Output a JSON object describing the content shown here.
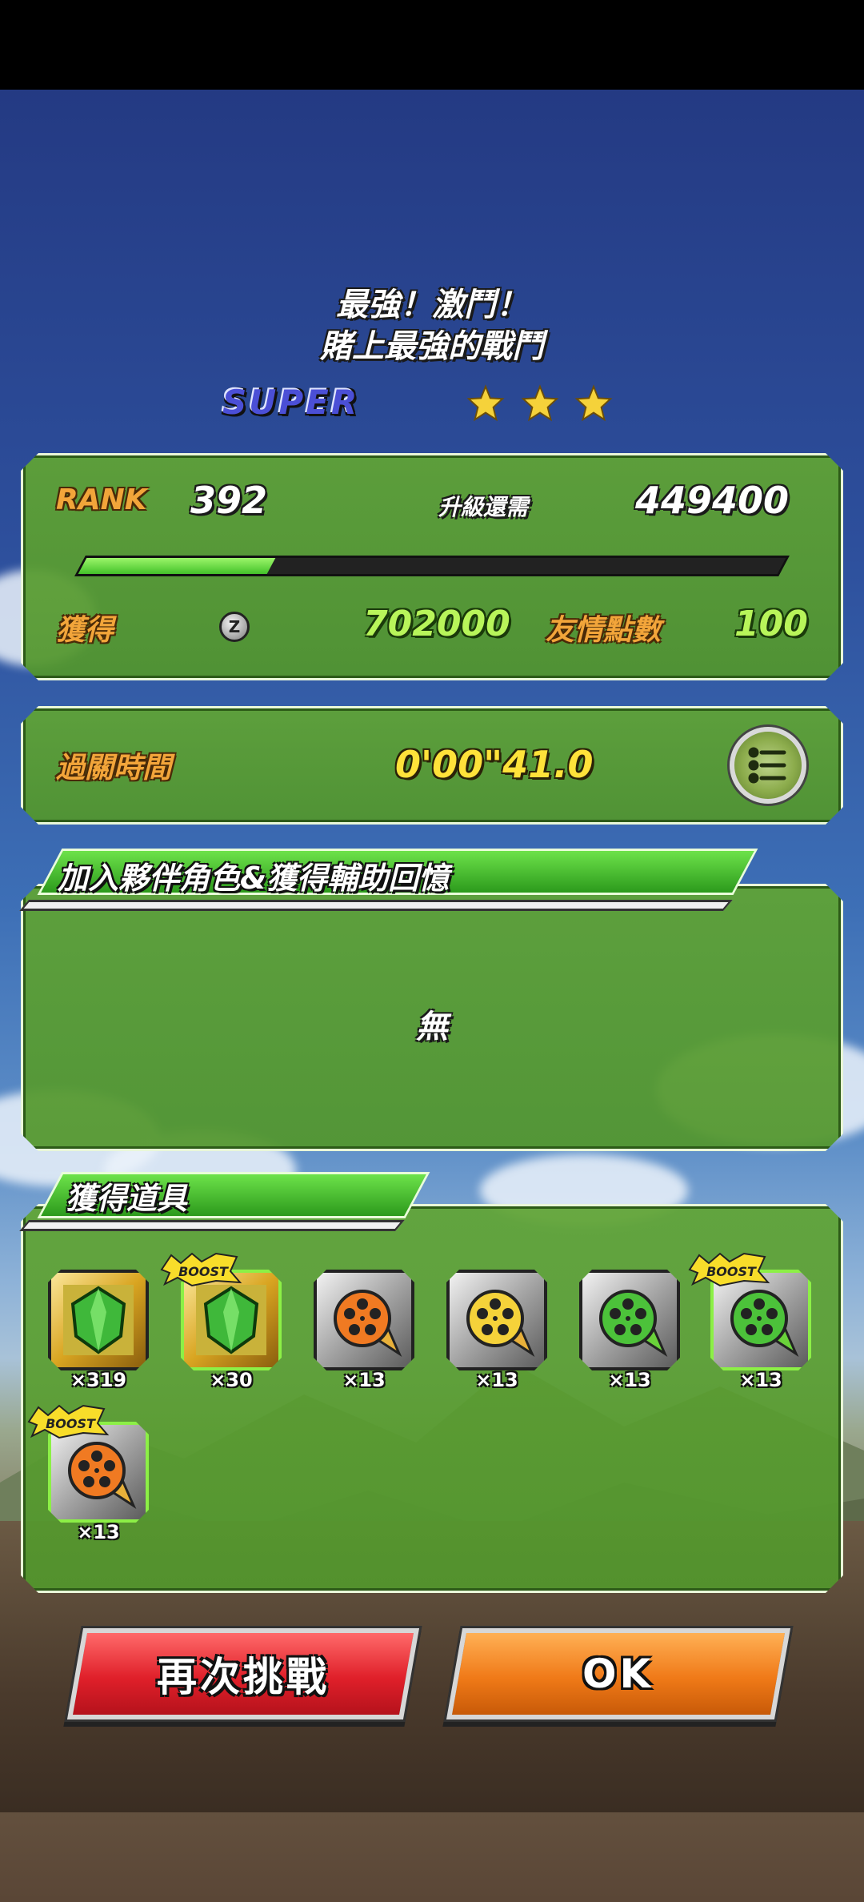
{
  "title": {
    "line1": "最強！激鬥！",
    "line2": "賭上最強的戰鬥"
  },
  "difficulty": "SUPER",
  "stars": {
    "earned": 3,
    "total": 3,
    "color": "#f5d23a"
  },
  "rank_panel": {
    "rank_label": "RANK",
    "rank_value": "392",
    "next_label": "升級還需",
    "next_value": "449400",
    "progress_fraction": 0.27,
    "obtain_label": "獲得",
    "zeni_icon": "zeni-coin-icon",
    "zeni_value": "702000",
    "friend_label": "友情點數",
    "friend_value": "100"
  },
  "clear_time": {
    "label": "過關時間",
    "value": "0'00\"41.0",
    "menu_icon": "list-menu-icon"
  },
  "recruit_section": {
    "title": "加入夥伴角色&獲得輔助回憶",
    "empty_text": "無"
  },
  "items_section": {
    "title": "獲得道具",
    "items": [
      {
        "icon": "green-gem-icon",
        "frame": "gold",
        "qty": "×319",
        "boost": false
      },
      {
        "icon": "green-gem-icon",
        "frame": "gold",
        "qty": "×30",
        "boost": true
      },
      {
        "icon": "orange-film-reel-icon",
        "frame": "silver",
        "qty": "×13",
        "boost": false
      },
      {
        "icon": "yellow-film-reel-icon",
        "frame": "silver",
        "qty": "×13",
        "boost": false
      },
      {
        "icon": "green-film-reel-icon",
        "frame": "silver",
        "qty": "×13",
        "boost": false
      },
      {
        "icon": "green-film-reel-icon",
        "frame": "silver",
        "qty": "×13",
        "boost": true
      },
      {
        "icon": "orange-film-reel-icon",
        "frame": "silver",
        "qty": "×13",
        "boost": true
      }
    ],
    "boost_label": "BOOST"
  },
  "buttons": {
    "retry": "再次挑戰",
    "ok": "OK"
  },
  "colors": {
    "panel_green": "#5fa434",
    "label_orange": "#f2a53a",
    "value_green": "#b8f55a",
    "value_yellow": "#ffe23a",
    "retry_red": "#e0202a",
    "ok_orange": "#f07a18"
  }
}
